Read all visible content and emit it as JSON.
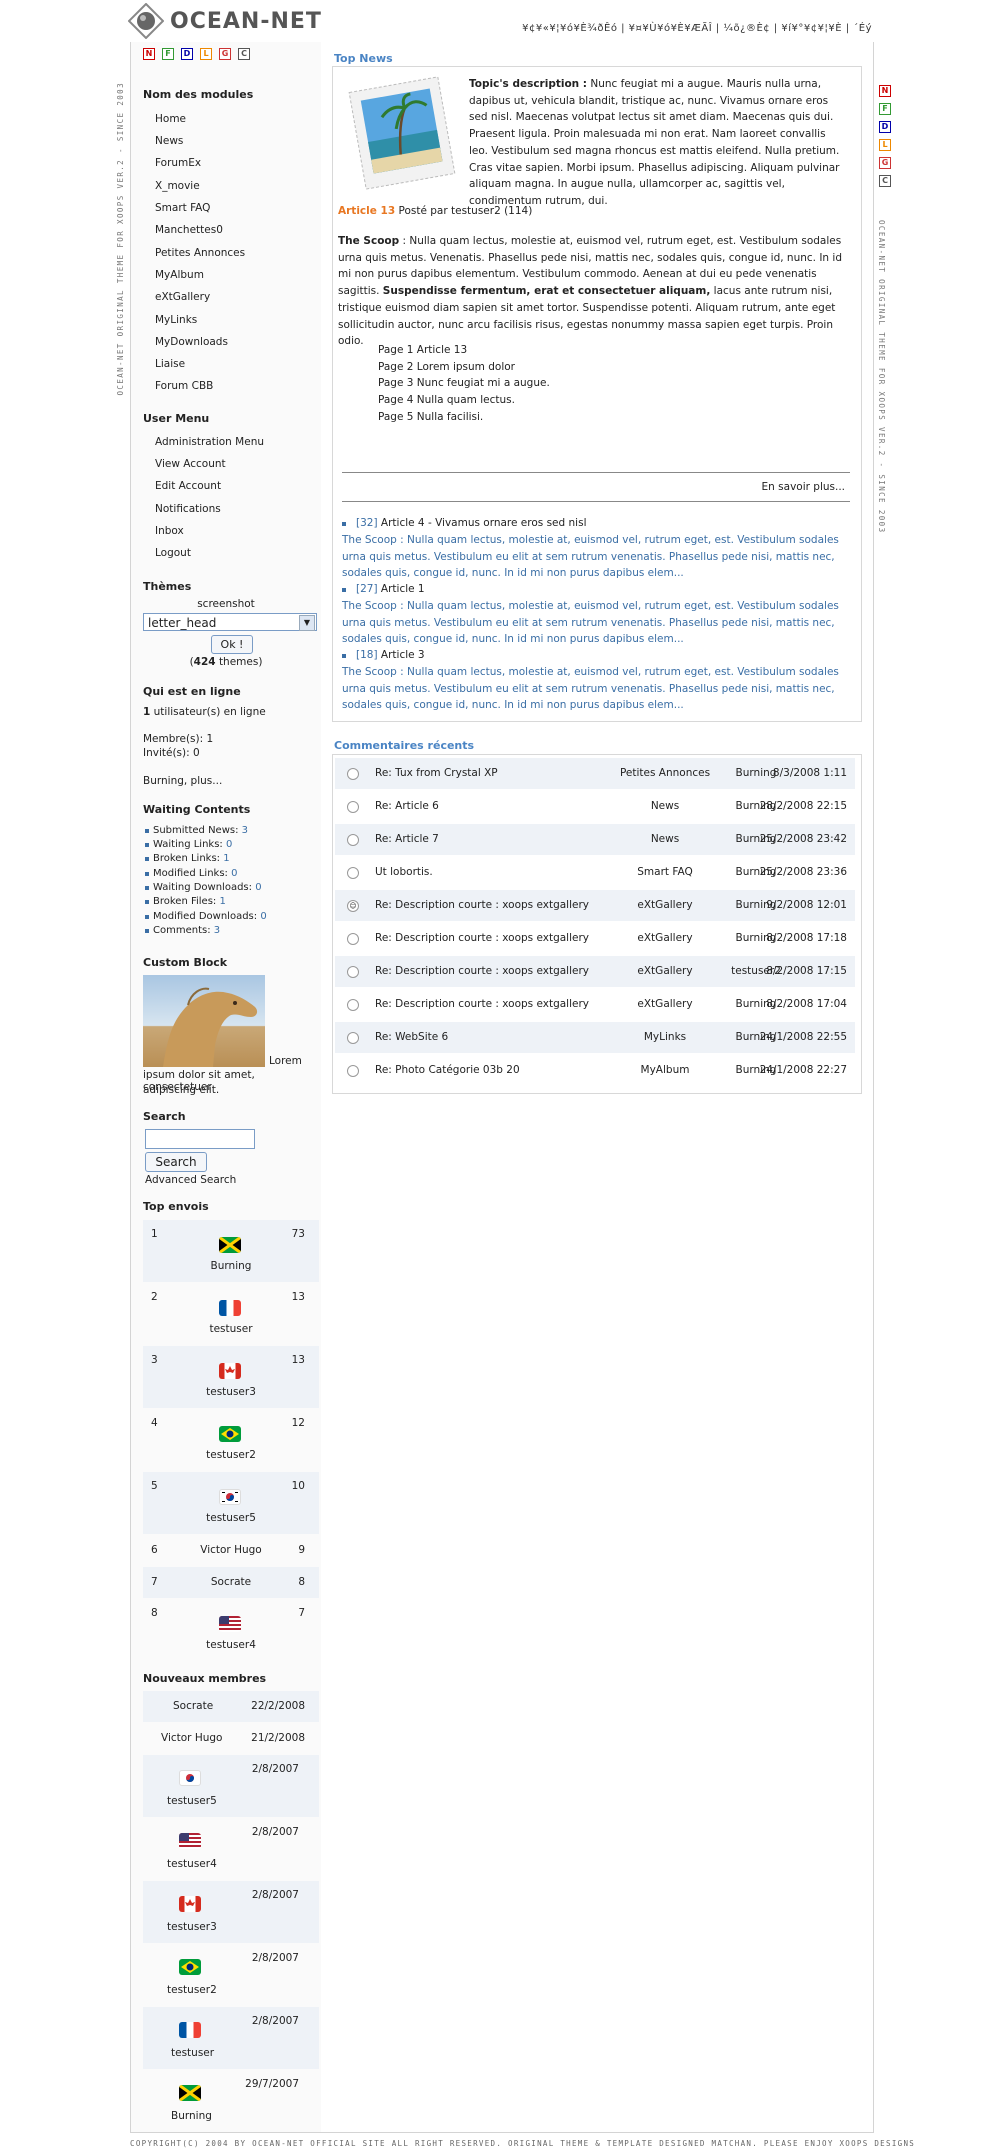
{
  "header": {
    "logo_text": "OCEAN-NET",
    "top_links": "¥¢¥«¥¦¥ó¥È¾ðÊó | ¥¤¥Ù¥ó¥È¥ÆÃÎ | ¼õ¿®È¢ | ¥í¥°¥¢¥¦¥È | ´Éý"
  },
  "languages": [
    "N",
    "F",
    "D",
    "L",
    "G",
    "C"
  ],
  "vertical_text": "OCEAN-NET ORIGINAL THEME FOR XOOPS VER.2 - SINCE 2003",
  "sidebar": {
    "modules_title": "Nom des modules",
    "modules": [
      "Home",
      "News",
      "ForumEx",
      "X_movie",
      "Smart FAQ",
      "Manchettes0",
      "Petites Annonces",
      "MyAlbum",
      "eXtGallery",
      "MyLinks",
      "MyDownloads",
      "Liaise",
      "Forum CBB"
    ],
    "user_menu_title": "User Menu",
    "user_menu": [
      "Administration Menu",
      "View Account",
      "Edit Account",
      "Notifications",
      "Inbox",
      "Logout"
    ],
    "themes_title": "Thèmes",
    "themes_screenshot": "screenshot",
    "themes_select": "letter_head",
    "themes_ok": "Ok !",
    "themes_count": "424",
    "themes_suffix": "themes)",
    "online_title": "Qui est en ligne",
    "online_count": "1",
    "online_text": "utilisateur(s) en ligne",
    "online_members": "Membre(s): 1",
    "online_guests": "Invité(s): 0",
    "online_names": "Burning, plus...",
    "waiting_title": "Waiting Contents",
    "waiting": [
      {
        "label": "Submitted News:",
        "value": "3"
      },
      {
        "label": "Waiting Links:",
        "value": "0"
      },
      {
        "label": "Broken Links:",
        "value": "1"
      },
      {
        "label": "Modified Links:",
        "value": "0"
      },
      {
        "label": "Waiting Downloads:",
        "value": "0"
      },
      {
        "label": "Broken Files:",
        "value": "1"
      },
      {
        "label": "Modified Downloads:",
        "value": "0"
      },
      {
        "label": "Comments:",
        "value": "3"
      }
    ],
    "custom_title": "Custom Block",
    "custom_text_1": "Lorem",
    "custom_text_2": "ipsum dolor sit amet, consectetuer",
    "custom_text_3": "adipiscing elit.",
    "search_title": "Search",
    "search_button": "Search",
    "search_advanced": "Advanced Search",
    "top_title": "Top envois",
    "top": [
      {
        "rank": "1",
        "name": "Burning",
        "count": "73",
        "flag": "jamaica"
      },
      {
        "rank": "2",
        "name": "testuser",
        "count": "13",
        "flag": "france"
      },
      {
        "rank": "3",
        "name": "testuser3",
        "count": "13",
        "flag": "canada"
      },
      {
        "rank": "4",
        "name": "testuser2",
        "count": "12",
        "flag": "brazil"
      },
      {
        "rank": "5",
        "name": "testuser5",
        "count": "10",
        "flag": "korea"
      },
      {
        "rank": "6",
        "name": "Victor Hugo",
        "count": "9",
        "flag": ""
      },
      {
        "rank": "7",
        "name": "Socrate",
        "count": "8",
        "flag": ""
      },
      {
        "rank": "8",
        "name": "testuser4",
        "count": "7",
        "flag": "usa"
      }
    ],
    "new_title": "Nouveaux membres",
    "new_members": [
      {
        "name": "Socrate",
        "date": "22/2/2008",
        "flag": ""
      },
      {
        "name": "Victor Hugo",
        "date": "21/2/2008",
        "flag": ""
      },
      {
        "name": "testuser5",
        "date": "2/8/2007",
        "flag": "korea"
      },
      {
        "name": "testuser4",
        "date": "2/8/2007",
        "flag": "usa"
      },
      {
        "name": "testuser3",
        "date": "2/8/2007",
        "flag": "canada"
      },
      {
        "name": "testuser2",
        "date": "2/8/2007",
        "flag": "brazil"
      },
      {
        "name": "testuser",
        "date": "2/8/2007",
        "flag": "france"
      },
      {
        "name": "Burning",
        "date": "29/7/2007",
        "flag": "jamaica"
      }
    ]
  },
  "news": {
    "title": "Top News",
    "topic_label": "Topic's description :",
    "topic_text": "Nunc feugiat mi a augue. Mauris nulla urna, dapibus ut, vehicula blandit, tristique ac, nunc. Vivamus ornare eros sed nisl. Maecenas volutpat lectus sit amet diam. Maecenas quis dui. Praesent ligula. Proin malesuada mi non erat. Nam laoreet convallis leo. Vestibulum sed magna rhoncus est mattis eleifend. Nulla pretium. Cras vitae sapien. Morbi ipsum. Phasellus adipiscing. Aliquam pulvinar aliquam magna. In augue nulla, ullamcorper ac, sagittis vel, condimentum rutrum, dui.",
    "article_title": "Article 13",
    "article_meta": "Posté par testuser2 (114)",
    "scoop_label": "The Scoop",
    "scoop_text": ": Nulla quam lectus, molestie at, euismod vel, rutrum eget, est. Vestibulum sodales urna quis metus. Venenatis. Phasellus pede nisi, mattis nec, sodales quis, congue id, nunc. In id mi non purus dapibus elementum. Vestibulum commodo. Aenean at dui eu pede venenatis sagittis.",
    "scoop_bold": "Suspendisse fermentum, erat et consectetuer aliquam,",
    "scoop_rest": "lacus ante rutrum nisi, tristique euismod diam sapien sit amet tortor. Suspendisse potenti. Aliquam rutrum, ante eget sollicitudin auctor, nunc arcu facilisis risus, egestas nonummy massa sapien eget turpis. Proin odio.",
    "pages": [
      "Page 1 Article 13",
      "Page 2 Lorem ipsum dolor",
      "Page 3 Nunc feugiat mi a augue.",
      "Page 4 Nulla quam lectus.",
      "Page 5 Nulla facilisi."
    ],
    "read_more": "En savoir plus...",
    "related": [
      {
        "id": "[32]",
        "title": "Article 4 - Vivamus ornare eros sed nisl",
        "teaser": "The Scoop : Nulla quam lectus, molestie at, euismod vel, rutrum eget, est. Vestibulum sodales urna quis metus. Vestibulum eu elit at sem rutrum venenatis. Phasellus pede nisi, mattis nec, sodales quis, congue id, nunc. In id mi non purus dapibus elem..."
      },
      {
        "id": "[27]",
        "title": "Article 1",
        "teaser": "The Scoop : Nulla quam lectus, molestie at, euismod vel, rutrum eget, est. Vestibulum sodales urna quis metus. Vestibulum eu elit at sem rutrum venenatis. Phasellus pede nisi, mattis nec, sodales quis, congue id, nunc. In id mi non purus dapibus elem..."
      },
      {
        "id": "[18]",
        "title": "Article 3",
        "teaser": "The Scoop : Nulla quam lectus, molestie at, euismod vel, rutrum eget, est. Vestibulum sodales urna quis metus. Vestibulum eu elit at sem rutrum venenatis. Phasellus pede nisi, mattis nec, sodales quis, congue id, nunc. In id mi non purus dapibus elem..."
      }
    ]
  },
  "comments": {
    "title": "Commentaires récents",
    "rows": [
      {
        "subject": "Re: Tux from Crystal XP",
        "module": "Petites Annonces",
        "user": "Burning",
        "date": "8/3/2008 1:11"
      },
      {
        "subject": "Re: Article 6",
        "module": "News",
        "user": "Burning",
        "date": "28/2/2008 22:15"
      },
      {
        "subject": "Re: Article 7",
        "module": "News",
        "user": "Burning",
        "date": "25/2/2008 23:42"
      },
      {
        "subject": "Ut lobortis.",
        "module": "Smart FAQ",
        "user": "Burning",
        "date": "25/2/2008 23:36"
      },
      {
        "subject": "Re: Description courte : xoops extgallery",
        "module": "eXtGallery",
        "user": "Burning",
        "date": "9/2/2008 12:01"
      },
      {
        "subject": "Re: Description courte : xoops extgallery",
        "module": "eXtGallery",
        "user": "Burning",
        "date": "8/2/2008 17:18"
      },
      {
        "subject": "Re: Description courte : xoops extgallery",
        "module": "eXtGallery",
        "user": "testuser2",
        "date": "8/2/2008 17:15"
      },
      {
        "subject": "Re: Description courte : xoops extgallery",
        "module": "eXtGallery",
        "user": "Burning",
        "date": "8/2/2008 17:04"
      },
      {
        "subject": "Re: WebSite 6",
        "module": "MyLinks",
        "user": "Burning",
        "date": "24/1/2008 22:55"
      },
      {
        "subject": "Re: Photo Catégorie 03b 20",
        "module": "MyAlbum",
        "user": "Burning",
        "date": "24/1/2008 22:27"
      }
    ]
  },
  "footer": "COPYRIGHT(C) 2004 BY OCEAN-NET OFFICIAL SITE ALL RIGHT RESERVED. ORIGINAL THEME & TEMPLATE DESIGNED MATCHAN. PLEASE ENJOY XOOPS DESIGNS"
}
